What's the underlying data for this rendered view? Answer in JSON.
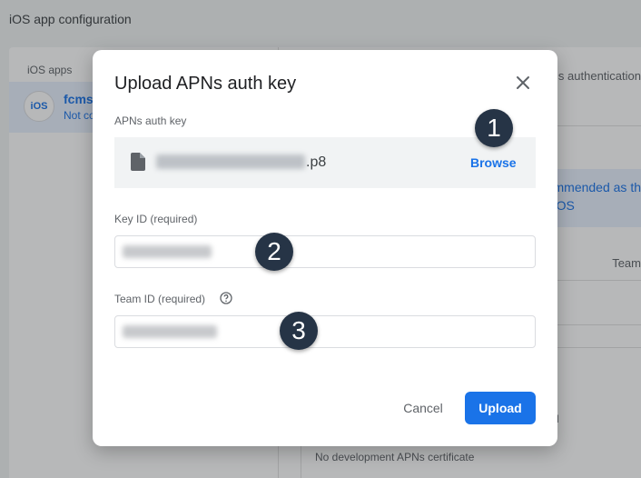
{
  "page": {
    "title": "iOS app configuration"
  },
  "apps_panel": {
    "heading": "iOS apps",
    "item": {
      "icon_label": "iOS",
      "name": "fcms",
      "subtitle": "Not co"
    }
  },
  "right_panel": {
    "auth_text": "s authentication",
    "recommended_line1": "mmended as th",
    "recommended_line2": "iOS",
    "team_col": "Team",
    "tick_char": "l",
    "no_dev_cert": "No development APNs certificate"
  },
  "dialog": {
    "title": "Upload APNs auth key",
    "close_icon": "close-icon",
    "auth_key_label": "APNs auth key",
    "file_icon": "file-icon",
    "file_ext": ".p8",
    "browse_label": "Browse",
    "key_id_label": "Key ID (required)",
    "team_id_label": "Team ID (required)",
    "help_icon": "help-circle-icon",
    "cancel_label": "Cancel",
    "upload_label": "Upload"
  },
  "step_badges": [
    "1",
    "2",
    "3"
  ],
  "colors": {
    "accent": "#1a73e8",
    "badge": "#263446",
    "selected_bg": "#e8f0fe"
  }
}
